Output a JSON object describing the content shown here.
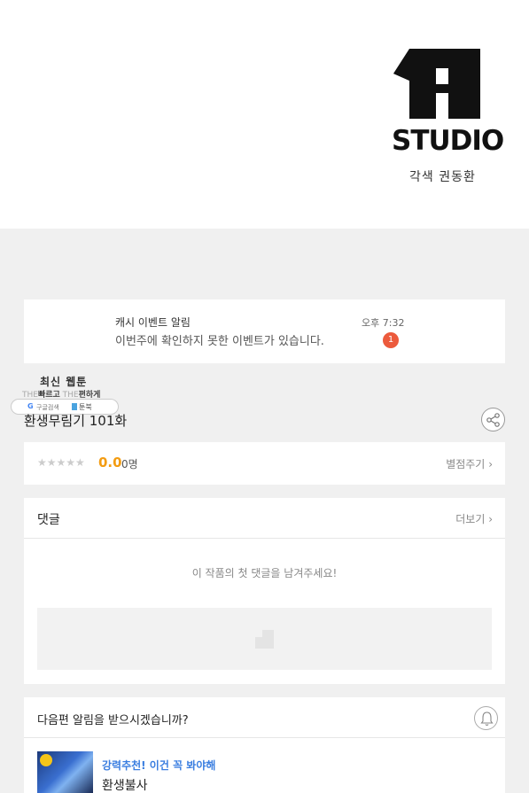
{
  "banner": {
    "logo_text": "STUDIO",
    "logo_subtitle": "각색 권동환"
  },
  "notice": {
    "title": "캐시 이벤트 알림",
    "body": "이번주에 확인하지 못한 이벤트가 있습니다.",
    "time": "오후 7:32",
    "badge_count": "1"
  },
  "promo": {
    "title": "최신 웹툰",
    "line_faint_1": "THE",
    "line_bold_1": "빠르고",
    "line_faint_2": "THE",
    "line_bold_2": "편하게",
    "google_letter": "G",
    "google_label": "구글검색",
    "toonbook_label": "툰북"
  },
  "episode": {
    "title": "환생무림기 101화"
  },
  "rating": {
    "stars": "★★★★★",
    "star_value": 0,
    "score": "0.0",
    "count": "0명",
    "rate_button": "별점주기"
  },
  "comments": {
    "title": "댓글",
    "more": "더보기",
    "empty_message": "이 작품의 첫 댓글을 남겨주세요!"
  },
  "next_episode": {
    "question": "다음편 알림을 받으시겠습니까?",
    "recommend_label": "강력추천! 이건 꼭 봐야해",
    "recommend_title": "환생불사"
  },
  "colors": {
    "badge": "#ec5a3c",
    "score": "#f39c12",
    "recommend": "#3a7ee0",
    "background": "#f0f0f0"
  }
}
